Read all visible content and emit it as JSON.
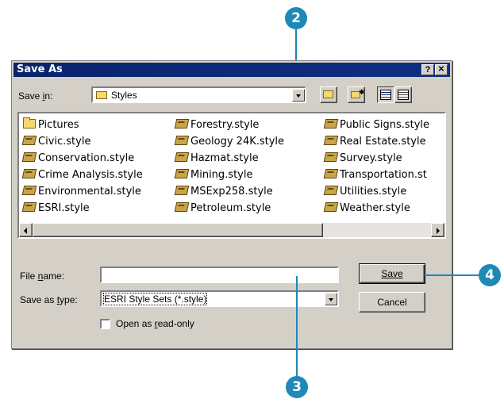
{
  "window": {
    "title": "Save As",
    "help_btn": "?",
    "close_btn": "✕"
  },
  "toolbar": {
    "save_in_label": "Save in:",
    "save_in_value": "Styles",
    "icons": [
      "up-one-level-icon",
      "create-new-folder-icon",
      "list-view-icon",
      "details-view-icon"
    ]
  },
  "files": {
    "col1": [
      {
        "name": "Pictures",
        "icon": "folder"
      },
      {
        "name": "Civic.style",
        "icon": "style"
      },
      {
        "name": "Conservation.style",
        "icon": "style"
      },
      {
        "name": "Crime Analysis.style",
        "icon": "style"
      },
      {
        "name": "Environmental.style",
        "icon": "style"
      },
      {
        "name": "ESRI.style",
        "icon": "style"
      }
    ],
    "col2": [
      {
        "name": "Forestry.style",
        "icon": "style"
      },
      {
        "name": "Geology 24K.style",
        "icon": "style"
      },
      {
        "name": "Hazmat.style",
        "icon": "style"
      },
      {
        "name": "Mining.style",
        "icon": "style"
      },
      {
        "name": "MSExp258.style",
        "icon": "style"
      },
      {
        "name": "Petroleum.style",
        "icon": "style"
      }
    ],
    "col3": [
      {
        "name": "Public Signs.style",
        "icon": "style"
      },
      {
        "name": "Real Estate.style",
        "icon": "style"
      },
      {
        "name": "Survey.style",
        "icon": "style"
      },
      {
        "name": "Transportation.st",
        "icon": "style"
      },
      {
        "name": "Utilities.style",
        "icon": "style"
      },
      {
        "name": "Weather.style",
        "icon": "style"
      }
    ]
  },
  "form": {
    "file_name_label": "File name:",
    "file_name_value": "",
    "save_as_type_label": "Save as type:",
    "save_as_type_value": "ESRI Style Sets (*.style)",
    "read_only_label": "Open as read-only",
    "read_only_checked": false
  },
  "buttons": {
    "save": "Save",
    "cancel": "Cancel"
  },
  "callouts": {
    "c2": "2",
    "c3": "3",
    "c4": "4"
  },
  "colors": {
    "titlebar": "#0a246a",
    "callout": "#1e88b6",
    "face": "#d4d0c8"
  }
}
